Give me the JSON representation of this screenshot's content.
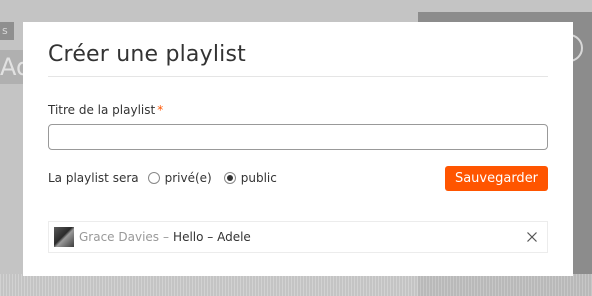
{
  "background": {
    "chip_text": "s",
    "title_text": "Ade"
  },
  "modal": {
    "title": "Créer une playlist",
    "playlist_title_label": "Titre de la playlist",
    "required_mark": "*",
    "playlist_title_value": "",
    "privacy_label": "La playlist sera",
    "privacy_options": [
      {
        "label": "privé(e)",
        "selected": false
      },
      {
        "label": "public",
        "selected": true
      }
    ],
    "save_label": "Sauvegarder",
    "track": {
      "artist": "Grace Davies",
      "separator": "–",
      "title": "Hello – Adele"
    }
  },
  "colors": {
    "accent": "#ff5500",
    "text": "#333333",
    "muted": "#999999"
  }
}
